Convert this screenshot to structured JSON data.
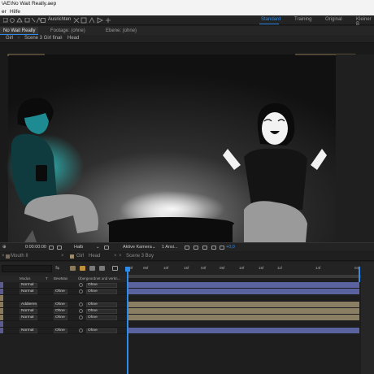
{
  "window": {
    "title": "\\AE\\No Wait Really.aep"
  },
  "menu": {
    "items": [
      "er",
      "Hilfe"
    ]
  },
  "toolbar": {
    "checkbox_label": "Ausrichten",
    "workspaces": [
      "Standard",
      "Training",
      "Original",
      "Kleiner B"
    ],
    "active_workspace": "Standard"
  },
  "panel_tabs": {
    "composition": "No Wait Really",
    "footage": "Footage: (ohne)",
    "layer": "Ebene: (ohne)"
  },
  "breadcrumbs": [
    "Girl",
    "Scene 3 Girl final",
    "Head"
  ],
  "viewer_bar": {
    "timecode": "0:00:00:00",
    "resolution": "Halb",
    "camera": "Aktive Kamera",
    "views": "1 Ansi...",
    "exposure": "+0,0"
  },
  "comp_tabs": [
    {
      "label": "Mouth II",
      "color": "#7a6a5a"
    },
    {
      "label": "Girl",
      "color": "#9a8c6a"
    },
    {
      "label": "Head",
      "color": "#8c7a5a"
    },
    {
      "label": "Scene 3 Boy",
      "color": "#7a6a5a"
    }
  ],
  "columns": {
    "mode": "Modus",
    "t": "T",
    "trkmat": "BewMas",
    "parent": "Übergeordnet und verkn..."
  },
  "ruler_ticks": [
    "00f",
    "05f",
    "10f",
    "15f",
    "20f",
    "01f",
    "05f",
    "10f",
    "15f",
    "20f",
    "02f",
    "05f",
    "10f",
    "15f",
    "20f",
    "03f",
    "05f",
    "10f",
    "15f",
    "20f",
    "04f",
    "05f",
    "10f",
    "15f",
    "20f",
    "05f"
  ],
  "ruler_labels": [
    "00f",
    "05f",
    "10f",
    "15f",
    "03f",
    "05f",
    "10f",
    "15f",
    "11f",
    "14f",
    "04f"
  ],
  "layers": [
    {
      "swatch": "#5b5b8f",
      "mode": "Normal",
      "trkmat": "",
      "parent": "Ohne",
      "bar": "#5a62a0"
    },
    {
      "swatch": "#5b5b8f",
      "mode": "Normal",
      "trkmat": "Ohne",
      "parent": "Ohne",
      "bar": "#5a62a0"
    },
    {
      "swatch": "#8a7a5a",
      "mode": "",
      "trkmat": "",
      "parent": "",
      "bar": ""
    },
    {
      "swatch": "#8a7a5a",
      "mode": "Addieren",
      "trkmat": "Ohne",
      "parent": "Ohne",
      "bar": "#8a7e63"
    },
    {
      "swatch": "#8a7a5a",
      "mode": "Normal",
      "trkmat": "Ohne",
      "parent": "Ohne",
      "bar": "#8a7e63"
    },
    {
      "swatch": "#8a7a5a",
      "mode": "Normal",
      "trkmat": "Ohne",
      "parent": "Ohne",
      "bar": "#8a7e63"
    },
    {
      "swatch": "#5b5b8f",
      "mode": "",
      "trkmat": "",
      "parent": "",
      "bar": ""
    },
    {
      "swatch": "#5b5b8f",
      "mode": "Normal",
      "trkmat": "Ohne",
      "parent": "Ohne",
      "bar": "#5a62a0"
    }
  ],
  "colors": {
    "accent": "#2d8ceb",
    "panel": "#232323",
    "viewer_bg": "#1a1a1a"
  }
}
